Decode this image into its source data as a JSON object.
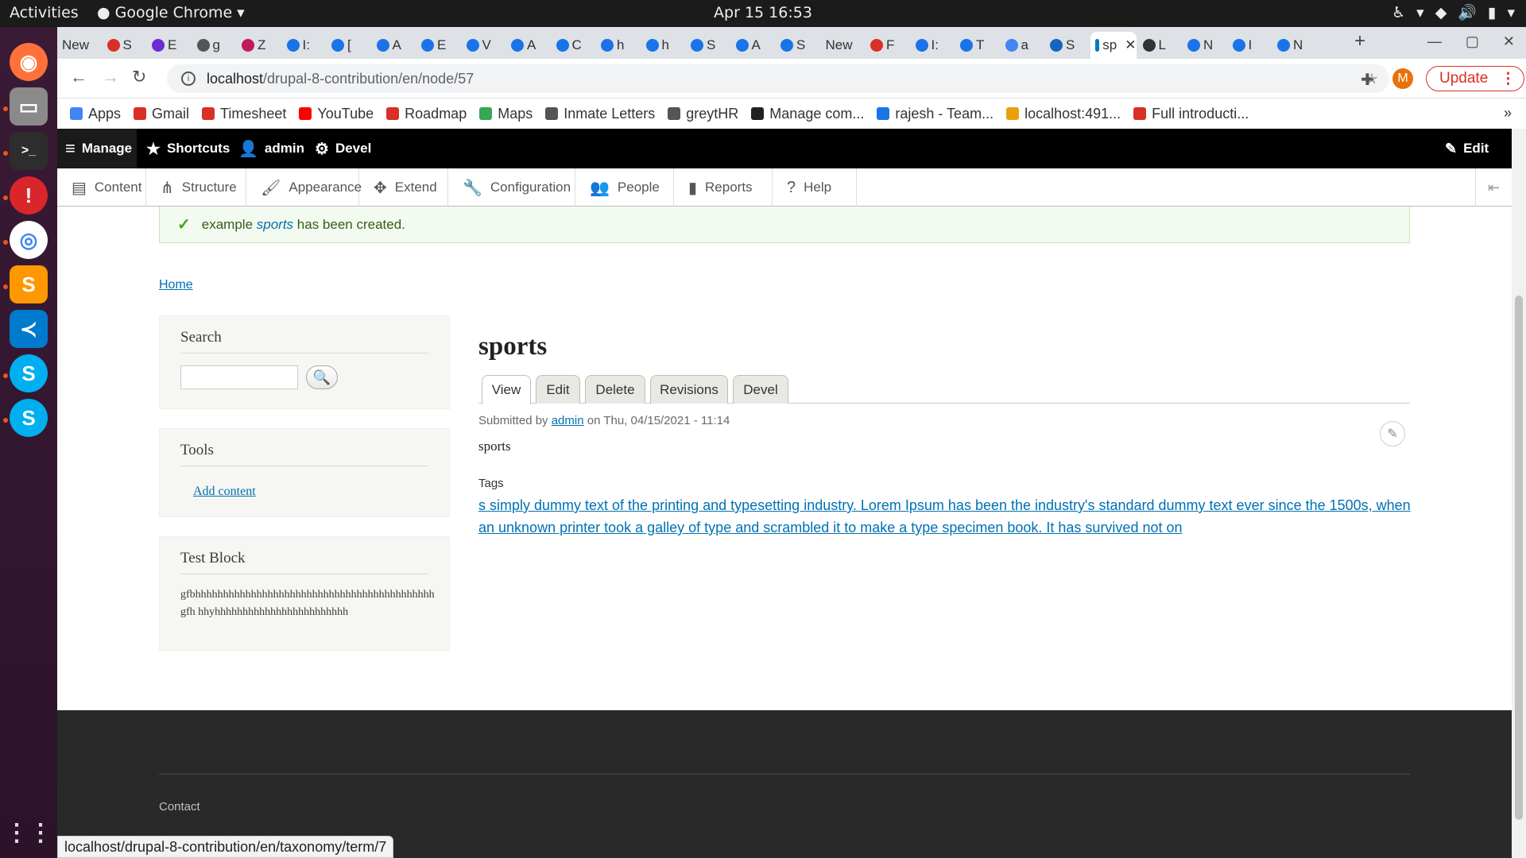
{
  "os": {
    "activities": "Activities",
    "app_name": "Google Chrome",
    "clock": "Apr 15  16:53"
  },
  "browser": {
    "tabs": [
      "New",
      "S",
      "E",
      "g",
      "Z",
      "I:",
      "[",
      "A",
      "E",
      "V",
      "A",
      "C",
      "h",
      "h",
      "S",
      "A",
      "S",
      "New",
      "F",
      "I:",
      "T",
      "a",
      "S",
      "sp",
      "L",
      "N",
      "I",
      "N"
    ],
    "url_host": "localhost",
    "url_path": "/drupal-8-contribution/en/node/57",
    "profile_initial": "M",
    "update_label": "Update",
    "bookmarks": [
      "Apps",
      "Gmail",
      "Timesheet",
      "YouTube",
      "Roadmap",
      "Maps",
      "Inmate Letters",
      "greytHR",
      "Manage com...",
      "rajesh - Team...",
      "localhost:491...",
      "Full introducti..."
    ],
    "status_url": "localhost/drupal-8-contribution/en/taxonomy/term/7"
  },
  "admin": {
    "manage": "Manage",
    "shortcuts": "Shortcuts",
    "user": "admin",
    "devel": "Devel",
    "edit": "Edit",
    "tray": [
      "Content",
      "Structure",
      "Appearance",
      "Extend",
      "Configuration",
      "People",
      "Reports",
      "Help"
    ]
  },
  "message": {
    "prefix": "example",
    "link": "sports",
    "suffix": "has been created."
  },
  "breadcrumb": "Home",
  "sidebar": {
    "search_title": "Search",
    "tools_title": "Tools",
    "add_content": "Add content",
    "test_title": "Test Block",
    "test_body": "gfbhhhhhhhhhhhhhhhhhhhhhhhhhhhhhhhhhhhhhhhhhhhgfh hhyhhhhhhhhhhhhhhhhhhhhhhhh"
  },
  "node": {
    "title": "sports",
    "tabs": [
      "View",
      "Edit",
      "Delete",
      "Revisions",
      "Devel"
    ],
    "submitted_by": "Submitted by",
    "author": "admin",
    "date": "on Thu, 04/15/2021 - 11:14",
    "body": "sports",
    "tags_label": "Tags",
    "tags_value": "s simply dummy text of the printing and typesetting industry. Lorem Ipsum has been the industry's standard dummy text ever since the 1500s, when an unknown printer took a galley of type and scrambled it to make a type specimen book. It has survived not on"
  },
  "footer": {
    "contact": "Contact"
  },
  "colors": {
    "link": "#0071b3",
    "admin_bar": "#000000",
    "message_bg": "#f3faef",
    "footer_bg": "#292929"
  }
}
